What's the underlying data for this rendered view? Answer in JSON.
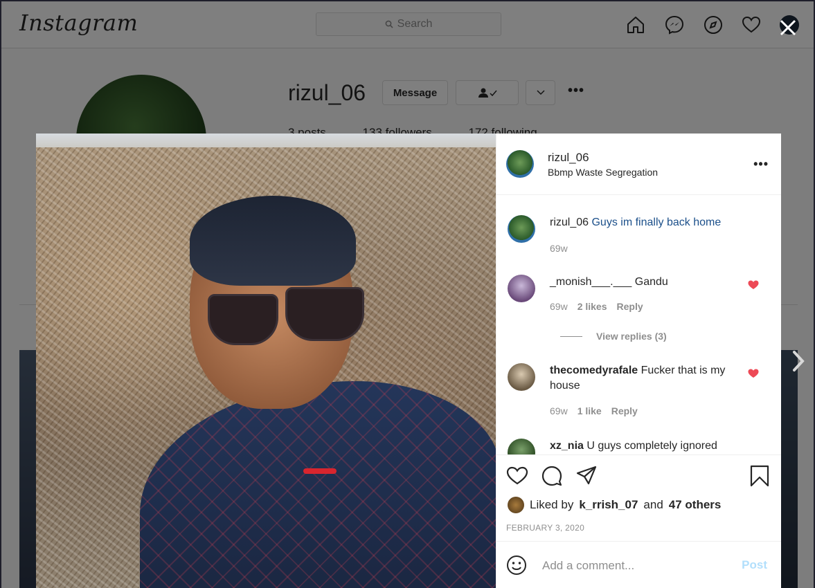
{
  "header": {
    "logo": "Instagram",
    "search_placeholder": "Search"
  },
  "profile": {
    "username": "rizul_06",
    "message_label": "Message",
    "stats": [
      "3 posts",
      "133 followers",
      "172 following"
    ]
  },
  "post": {
    "username": "rizul_06",
    "location": "Bbmp Waste Segregation",
    "caption": {
      "username": "rizul_06",
      "text": "Guys im finally back home",
      "time": "69w"
    },
    "comments": [
      {
        "username": "_monish___.___",
        "text": "Gandu",
        "time": "69w",
        "likes": "2 likes",
        "reply": "Reply",
        "view_replies": "View replies (3)"
      },
      {
        "username": "thecomedyrafale",
        "text": "Fucker that is my house",
        "time": "69w",
        "likes": "1 like",
        "reply": "Reply"
      },
      {
        "username": "xz_nia",
        "text": "U guys completely ignored"
      }
    ],
    "liked_by_prefix": "Liked by",
    "liked_by_user": "k_rrish_07",
    "liked_by_and": "and",
    "liked_by_others": "47 others",
    "date": "FEBRUARY 3, 2020",
    "add_comment_placeholder": "Add a comment...",
    "post_label": "Post"
  },
  "colors": {
    "heart_red": "#ed4956",
    "post_button_disabled": "#b2dffc",
    "caption_text": "#1b4f8a"
  }
}
